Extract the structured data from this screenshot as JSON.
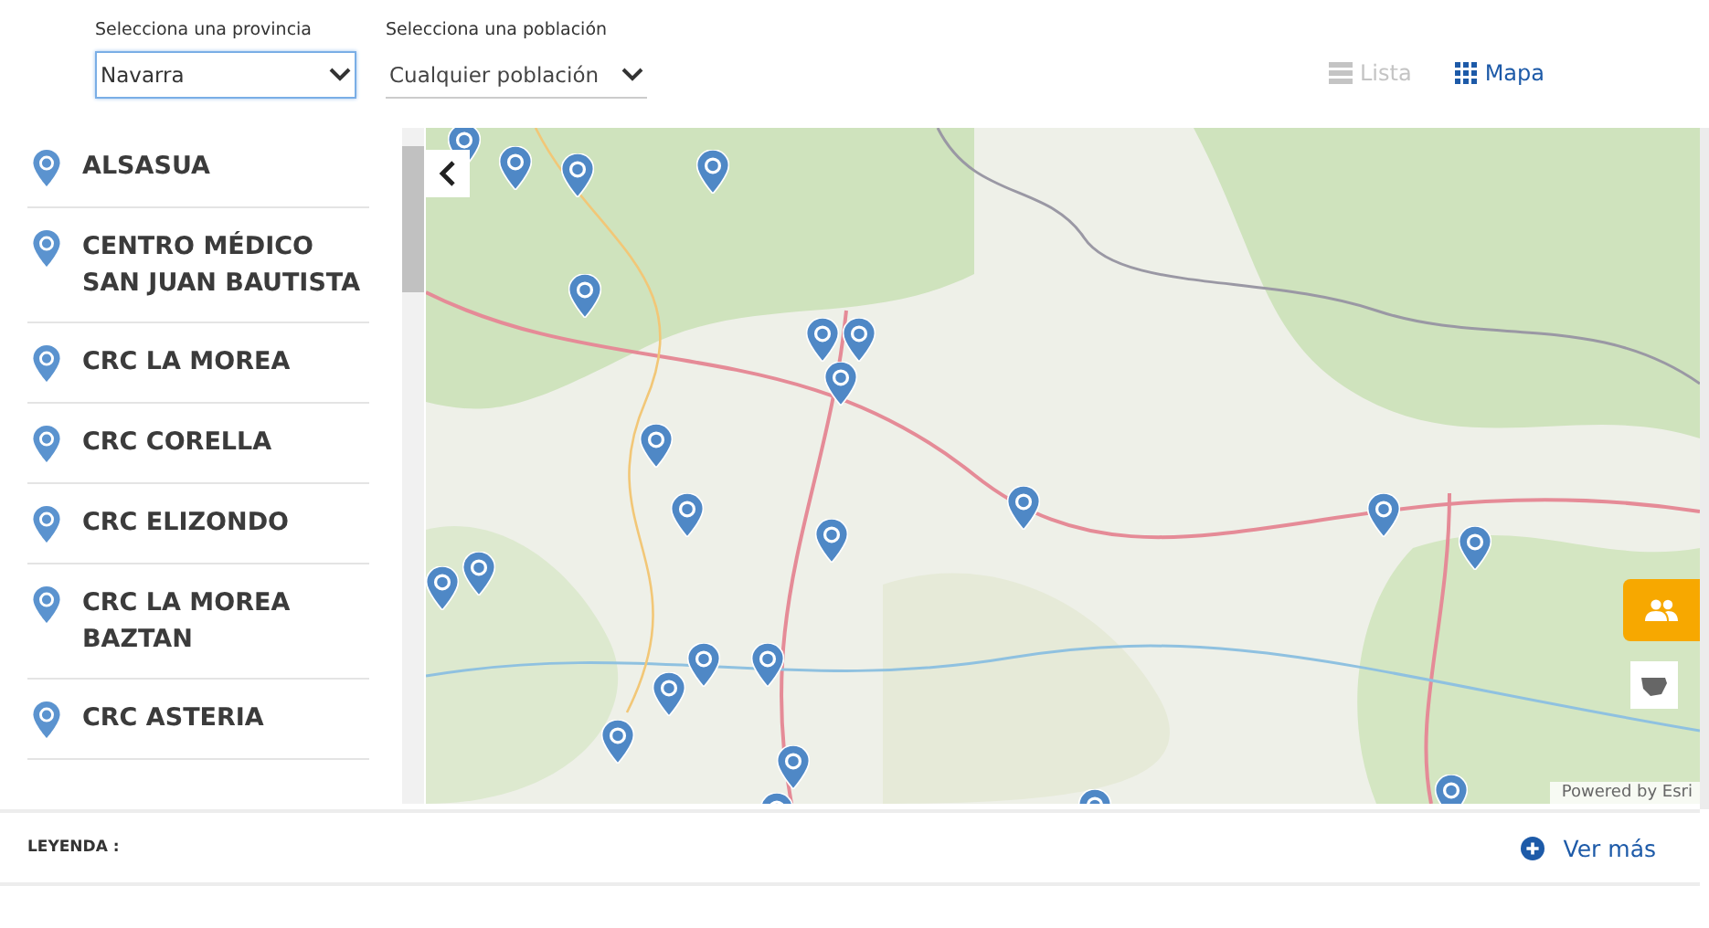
{
  "filters": [
    {
      "label": "Selecciona una provincia",
      "value": "Navarra",
      "focused": true
    },
    {
      "label": "Selecciona una población",
      "value": "Cualquier población",
      "focused": false
    }
  ],
  "views": [
    {
      "label": "Lista",
      "kind": "list",
      "selected": false
    },
    {
      "label": "Mapa",
      "kind": "grid",
      "selected": true
    }
  ],
  "centers": [
    {
      "name": "ALSASUA"
    },
    {
      "name": "CENTRO MÉDICO SAN JUAN BAUTISTA"
    },
    {
      "name": "CRC LA MOREA"
    },
    {
      "name": "CRC CORELLA"
    },
    {
      "name": "CRC ELIZONDO"
    },
    {
      "name": "CRC LA MOREA BAZTAN"
    },
    {
      "name": "CRC ASTERIA"
    }
  ],
  "map": {
    "kind": "picture",
    "attribution": "Powered by Esri"
  },
  "legend": {
    "label": "LEYENDA :",
    "more": "Ver más"
  }
}
